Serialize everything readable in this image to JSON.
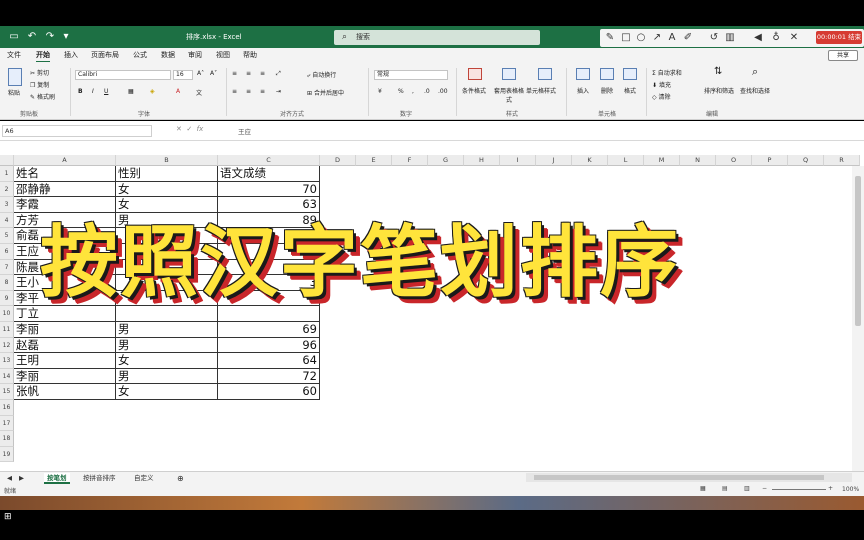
{
  "titlebar": {
    "doc_title": "排序.xlsx  -  Excel",
    "search_placeholder": "搜索",
    "recording_timer": "00:00:01 结束"
  },
  "menu": {
    "tabs": [
      "文件",
      "开始",
      "插入",
      "页面布局",
      "公式",
      "数据",
      "审阅",
      "视图",
      "帮助"
    ],
    "active_tab": "开始",
    "share_label": "共享"
  },
  "ribbon": {
    "clipboard": {
      "paste": "粘贴",
      "cut": "剪切",
      "copy": "复制",
      "format_painter": "格式刷",
      "label": "剪贴板"
    },
    "font": {
      "name": "Calibri",
      "size": "16",
      "label": "字体"
    },
    "alignment": {
      "wrap": "自动换行",
      "merge": "合并后居中",
      "label": "对齐方式"
    },
    "number": {
      "format": "常规",
      "label": "数字"
    },
    "styles": {
      "conditional": "条件格式",
      "table": "套用表格格式",
      "cell": "单元格样式",
      "label": "样式"
    },
    "cells": {
      "insert": "插入",
      "delete": "删除",
      "format": "格式",
      "label": "单元格"
    },
    "editing": {
      "autosum": "自动求和",
      "fill": "填充",
      "clear": "清除",
      "sort": "排序和筛选",
      "find": "查找和选择",
      "label": "编辑"
    }
  },
  "formula_bar": {
    "cell_ref": "A6",
    "value": "王应"
  },
  "grid": {
    "columns": [
      "A",
      "B",
      "C",
      "D",
      "E",
      "F",
      "G",
      "H",
      "I",
      "J",
      "K",
      "L",
      "M",
      "N",
      "O",
      "P",
      "Q",
      "R"
    ],
    "rows": [
      "1",
      "2",
      "3",
      "4",
      "5",
      "6",
      "7",
      "8",
      "9",
      "10",
      "11",
      "12",
      "13",
      "14",
      "15",
      "16",
      "17",
      "18",
      "19"
    ],
    "table": [
      [
        "姓名",
        "性别",
        "语文成绩"
      ],
      [
        "邵静静",
        "女",
        "70"
      ],
      [
        "李霞",
        "女",
        "63"
      ],
      [
        "方芳",
        "男",
        "89"
      ],
      [
        "俞磊",
        "",
        ""
      ],
      [
        "王应",
        "",
        ""
      ],
      [
        "陈晨",
        "",
        ""
      ],
      [
        "王小",
        "",
        "3"
      ],
      [
        "李平",
        "",
        ""
      ],
      [
        "丁立",
        "",
        ""
      ],
      [
        "李丽",
        "男",
        "69"
      ],
      [
        "赵磊",
        "男",
        "96"
      ],
      [
        "王明",
        "女",
        "64"
      ],
      [
        "李丽",
        "男",
        "72"
      ],
      [
        "张帆",
        "女",
        "60"
      ]
    ]
  },
  "sheets": {
    "tabs": [
      "按笔划",
      "按拼音排序",
      "自定义"
    ],
    "active": "按笔划"
  },
  "status": {
    "mode": "就绪",
    "zoom": "100%"
  },
  "overlay": {
    "title": "按照汉字笔划排序"
  },
  "colors": {
    "excel_green": "#1d7044",
    "overlay_yellow": "#ffe43b",
    "overlay_red": "#c9262a"
  }
}
